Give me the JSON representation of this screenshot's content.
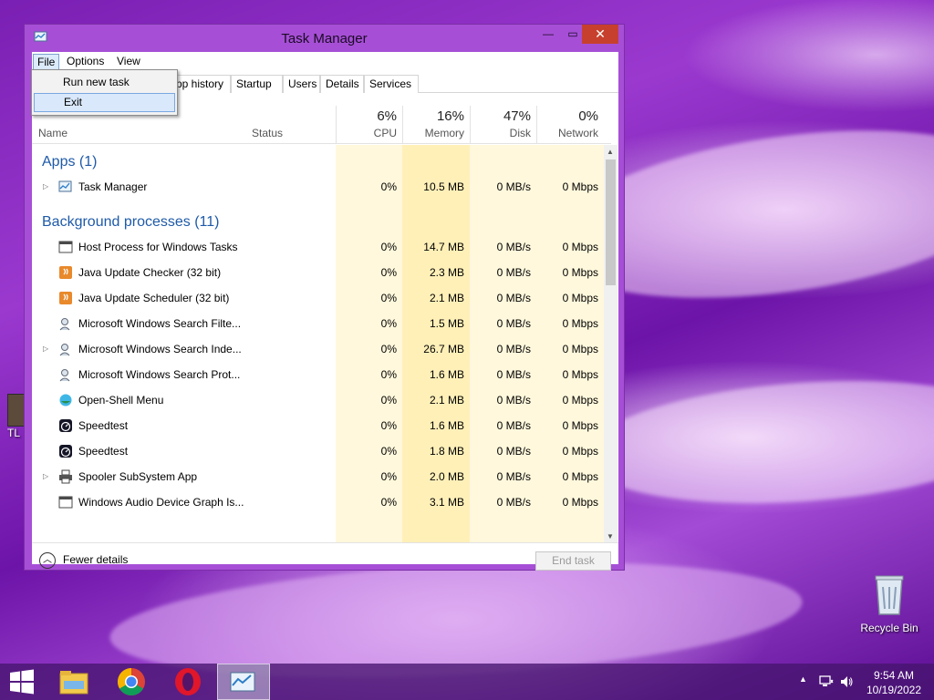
{
  "window": {
    "title": "Task Manager",
    "controls": {
      "minimize": "—",
      "maximize": "▭",
      "close": "✕"
    }
  },
  "menubar": {
    "file": "File",
    "options": "Options",
    "view": "View"
  },
  "file_menu": {
    "items": [
      "Run new task",
      "Exit"
    ],
    "highlighted": "Exit"
  },
  "tabs": [
    "pp history",
    "Startup",
    "Users",
    "Details",
    "Services"
  ],
  "columns": {
    "name": "Name",
    "status": "Status",
    "cpu": {
      "pct": "6%",
      "label": "CPU"
    },
    "memory": {
      "pct": "16%",
      "label": "Memory"
    },
    "disk": {
      "pct": "47%",
      "label": "Disk"
    },
    "network": {
      "pct": "0%",
      "label": "Network"
    }
  },
  "groups": {
    "apps": "Apps (1)",
    "background": "Background processes (11)"
  },
  "apps": [
    {
      "name": "Task Manager",
      "expandable": true,
      "icon": "taskmgr-icon",
      "cpu": "0%",
      "memory": "10.5 MB",
      "disk": "0 MB/s",
      "network": "0 Mbps"
    }
  ],
  "background": [
    {
      "name": "Host Process for Windows Tasks",
      "expandable": false,
      "icon": "window-icon",
      "cpu": "0%",
      "memory": "14.7 MB",
      "disk": "0 MB/s",
      "network": "0 Mbps"
    },
    {
      "name": "Java Update Checker (32 bit)",
      "expandable": false,
      "icon": "java-icon",
      "cpu": "0%",
      "memory": "2.3 MB",
      "disk": "0 MB/s",
      "network": "0 Mbps"
    },
    {
      "name": "Java Update Scheduler (32 bit)",
      "expandable": false,
      "icon": "java-icon",
      "cpu": "0%",
      "memory": "2.1 MB",
      "disk": "0 MB/s",
      "network": "0 Mbps"
    },
    {
      "name": "Microsoft Windows Search Filte...",
      "expandable": false,
      "icon": "search-user-icon",
      "cpu": "0%",
      "memory": "1.5 MB",
      "disk": "0 MB/s",
      "network": "0 Mbps"
    },
    {
      "name": "Microsoft Windows Search Inde...",
      "expandable": true,
      "icon": "search-user-icon",
      "cpu": "0%",
      "memory": "26.7 MB",
      "disk": "0 MB/s",
      "network": "0 Mbps"
    },
    {
      "name": "Microsoft Windows Search Prot...",
      "expandable": false,
      "icon": "search-user-icon",
      "cpu": "0%",
      "memory": "1.6 MB",
      "disk": "0 MB/s",
      "network": "0 Mbps"
    },
    {
      "name": "Open-Shell Menu",
      "expandable": false,
      "icon": "shell-icon",
      "cpu": "0%",
      "memory": "2.1 MB",
      "disk": "0 MB/s",
      "network": "0 Mbps"
    },
    {
      "name": "Speedtest",
      "expandable": false,
      "icon": "speedtest-icon",
      "cpu": "0%",
      "memory": "1.6 MB",
      "disk": "0 MB/s",
      "network": "0 Mbps"
    },
    {
      "name": "Speedtest",
      "expandable": false,
      "icon": "speedtest-icon",
      "cpu": "0%",
      "memory": "1.8 MB",
      "disk": "0 MB/s",
      "network": "0 Mbps"
    },
    {
      "name": "Spooler SubSystem App",
      "expandable": true,
      "icon": "printer-icon",
      "cpu": "0%",
      "memory": "2.0 MB",
      "disk": "0 MB/s",
      "network": "0 Mbps"
    },
    {
      "name": "Windows Audio Device Graph Is...",
      "expandable": false,
      "icon": "window-icon",
      "cpu": "0%",
      "memory": "3.1 MB",
      "disk": "0 MB/s",
      "network": "0 Mbps"
    }
  ],
  "footer": {
    "fewer_details": "Fewer details",
    "end_task": "End task"
  },
  "desktop": {
    "recycle_bin": "Recycle Bin",
    "partial_icon": "TL"
  },
  "taskbar": {
    "apps": [
      "start-icon",
      "file-explorer-icon",
      "chrome-icon",
      "opera-icon",
      "task-manager-icon"
    ],
    "time": "9:54 AM",
    "date": "10/19/2022"
  },
  "colors": {
    "accent_window": "#a64fd6",
    "group_text": "#1e5aa8",
    "cpu_tint": "#fff8dc",
    "memory_tint": "#fff0b8",
    "close_button": "#c7402d"
  }
}
